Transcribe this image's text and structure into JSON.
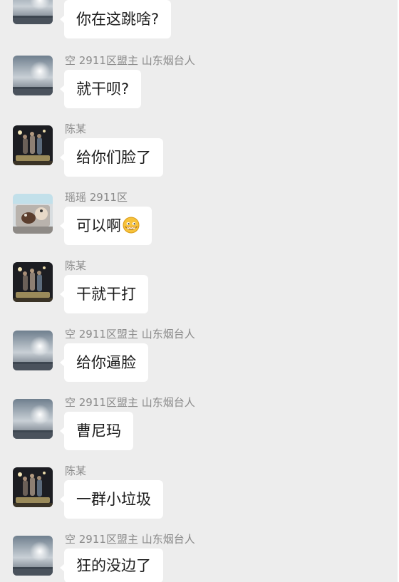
{
  "messages": [
    {
      "sender": "",
      "avatar": "avatar-sunset-icon",
      "text": "你在这跳啥?"
    },
    {
      "sender": "空 2911区盟主 山东烟台人",
      "avatar": "avatar-sunset-icon",
      "text": "就干呗?"
    },
    {
      "sender": "陈某",
      "avatar": "avatar-group-photo-icon",
      "text": "给你们脸了"
    },
    {
      "sender": "瑶瑶 2911区",
      "avatar": "avatar-pets-icon",
      "text": "可以啊",
      "emoji": "smirk-face-emoji"
    },
    {
      "sender": "陈某",
      "avatar": "avatar-group-photo-icon",
      "text": "干就干打"
    },
    {
      "sender": "空 2911区盟主 山东烟台人",
      "avatar": "avatar-sunset-icon",
      "text": "给你逼脸"
    },
    {
      "sender": "空 2911区盟主 山东烟台人",
      "avatar": "avatar-sunset-icon",
      "text": "曹尼玛"
    },
    {
      "sender": "陈某",
      "avatar": "avatar-group-photo-icon",
      "text": "一群小垃圾"
    },
    {
      "sender": "空 2911区盟主 山东烟台人",
      "avatar": "avatar-sunset-icon",
      "text": "狂的没边了"
    }
  ]
}
